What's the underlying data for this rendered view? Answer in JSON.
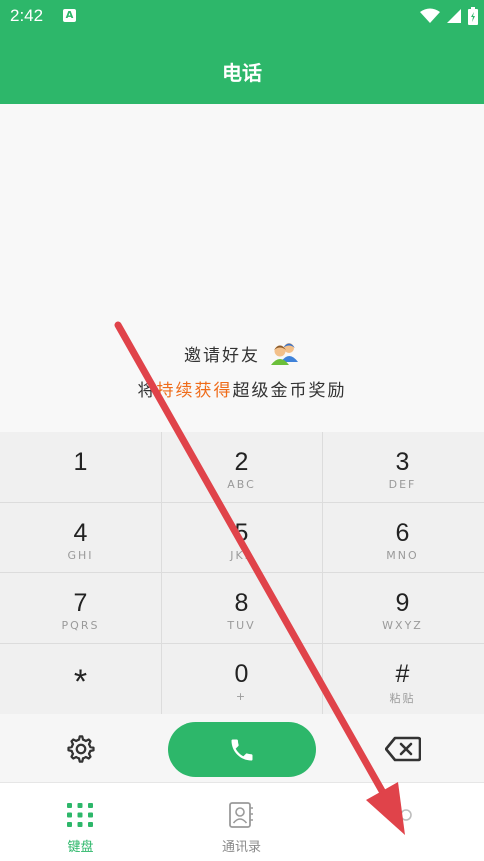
{
  "status_bar": {
    "time": "2:42",
    "notification_icon_letter": "A"
  },
  "header": {
    "title": "电话"
  },
  "invite": {
    "line1": "邀请好友",
    "line2_prefix": "将",
    "line2_highlight": "持续获得",
    "line2_suffix": "超级金币奖励",
    "highlight_color": "#ef6c1a"
  },
  "keypad": {
    "keys": [
      {
        "digit": "1",
        "letters": ""
      },
      {
        "digit": "2",
        "letters": "ABC"
      },
      {
        "digit": "3",
        "letters": "DEF"
      },
      {
        "digit": "4",
        "letters": "GHI"
      },
      {
        "digit": "5",
        "letters": "JKL"
      },
      {
        "digit": "6",
        "letters": "MNO"
      },
      {
        "digit": "7",
        "letters": "PQRS"
      },
      {
        "digit": "8",
        "letters": "TUV"
      },
      {
        "digit": "9",
        "letters": "WXYZ"
      },
      {
        "digit": "*",
        "letters": ""
      },
      {
        "digit": "0",
        "letters": "+"
      },
      {
        "digit": "#",
        "letters": "粘贴"
      }
    ]
  },
  "actions": {
    "settings_icon": "gear-icon",
    "call_icon": "phone-icon",
    "delete_icon": "backspace-icon"
  },
  "tabs": [
    {
      "label": "键盘",
      "icon": "dialpad-icon",
      "active": true
    },
    {
      "label": "通讯录",
      "icon": "contacts-icon",
      "active": false
    },
    {
      "label": "",
      "icon": "tab-icon",
      "active": false
    }
  ],
  "colors": {
    "brand": "#2db76a",
    "arrow": "#e0434a"
  }
}
